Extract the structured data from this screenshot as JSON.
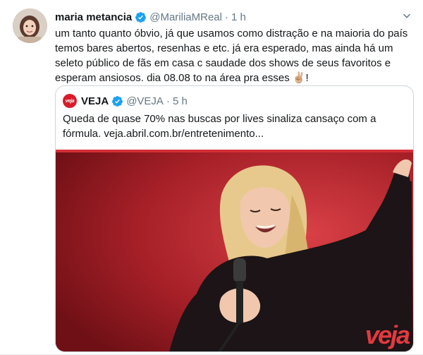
{
  "tweet": {
    "author_name": "maria metancia",
    "author_handle": "@MariliaMReal",
    "separator": "·",
    "time": "1 h",
    "text": "um tanto quanto óbvio, já que usamos como distração e na maioria do país temos bares abertos, resenhas e etc. já era esperado, mas ainda há um seleto público de fãs em casa c saudade dos shows de seus favoritos e esperam ansiosos. dia 08.08 to na área pra esses ✌🏼!",
    "avatar_icon": "avatar-photo",
    "verified_icon": "verified-badge-icon",
    "menu_icon": "chevron-down-icon"
  },
  "quote": {
    "logo_text": "veja",
    "author_name": "VEJA",
    "author_handle": "@VEJA",
    "separator": "·",
    "time": "5 h",
    "text": "Queda de quase 70% nas buscas por lives sinaliza cansaço com a fórmula. veja.abril.com.br/entretenimento...",
    "image_watermark": "veja"
  },
  "colors": {
    "text_primary": "#14171a",
    "text_secondary": "#657786",
    "verified_blue": "#1da1f2",
    "veja_red": "#d81b2a",
    "border": "#ccd6dd"
  }
}
